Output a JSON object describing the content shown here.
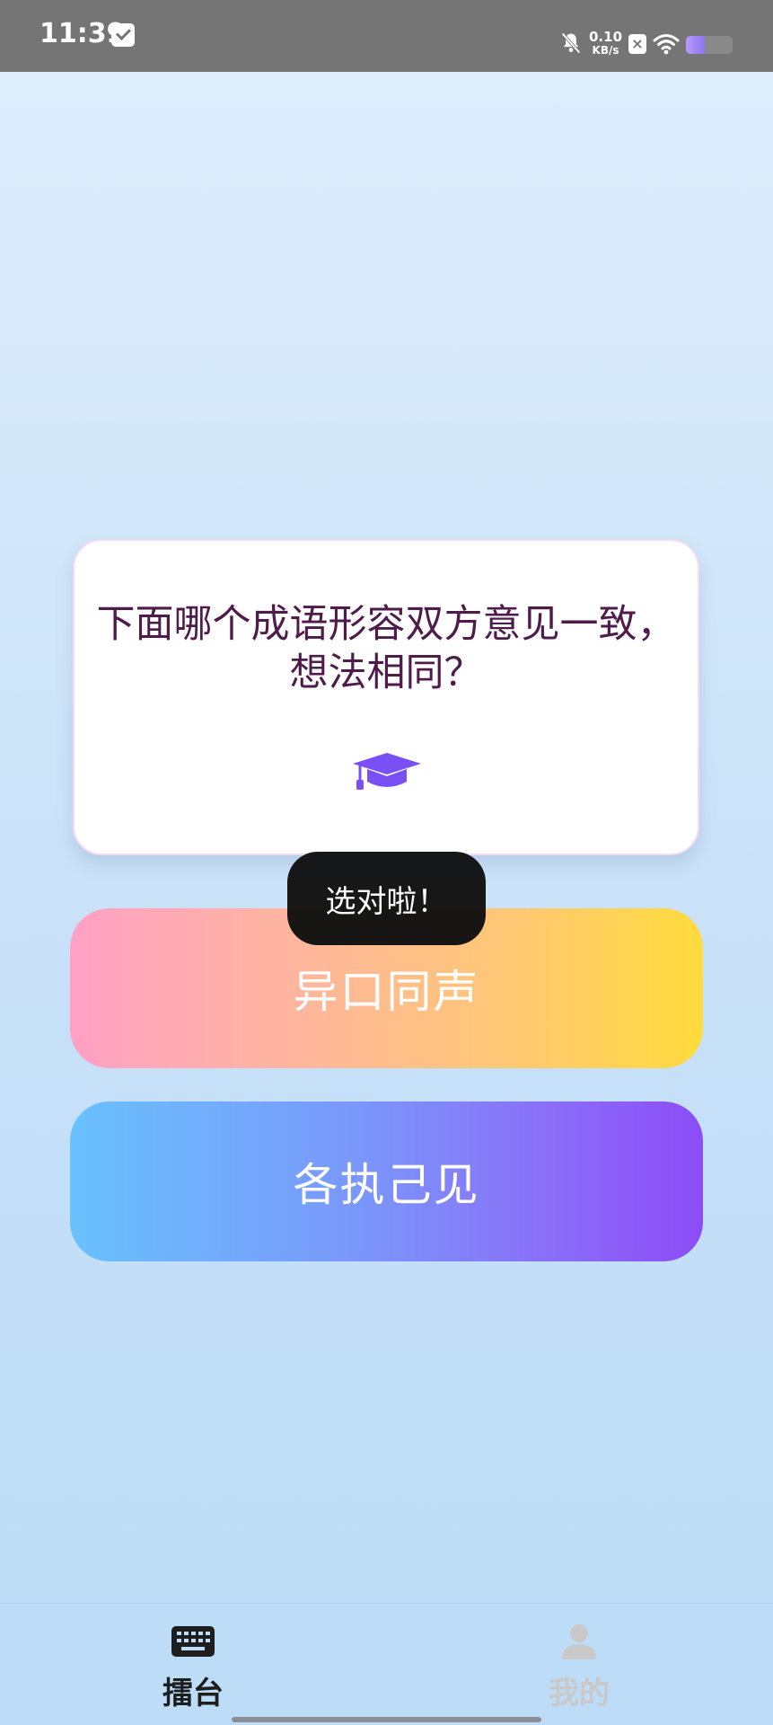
{
  "status_bar": {
    "time": "11:39",
    "net_speed_value": "0.10",
    "net_speed_unit": "KB/s",
    "x_badge": "×",
    "battery_level": 0.4
  },
  "question": {
    "text": "下面哪个成语形容双方意见一致，想法相同？",
    "icon": "graduation-cap-icon",
    "icon_color": "#7a4ff3"
  },
  "toast": {
    "text": "选对啦！"
  },
  "answers": [
    {
      "label": "异口同声"
    },
    {
      "label": "各执己见"
    }
  ],
  "bottom_nav": {
    "items": [
      {
        "label": "擂台",
        "icon": "keyboard-icon",
        "active": true
      },
      {
        "label": "我的",
        "icon": "person-icon",
        "active": false
      }
    ]
  }
}
